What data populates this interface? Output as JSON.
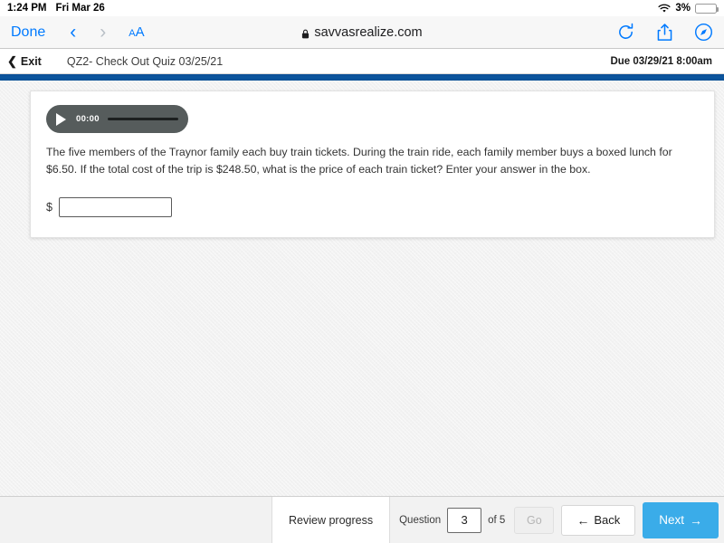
{
  "status_bar": {
    "time": "1:24 PM",
    "date": "Fri Mar 26",
    "battery_percent": "3%",
    "wifi_icon": "wifi-icon",
    "battery_icon": "battery-icon"
  },
  "browser": {
    "done_label": "Done",
    "back_icon": "chevron-left-icon",
    "forward_icon": "chevron-right-icon",
    "text_size_small": "A",
    "text_size_large": "A",
    "lock_icon": "lock-icon",
    "url": "savvasrealize.com",
    "reload_icon": "reload-icon",
    "share_icon": "share-icon",
    "compass_icon": "compass-icon"
  },
  "quiz_header": {
    "exit_label": "Exit",
    "exit_icon": "chevron-left-icon",
    "title": "QZ2- Check Out Quiz 03/25/21",
    "due": "Due 03/29/21 8:00am"
  },
  "question": {
    "audio": {
      "play_icon": "play-icon",
      "time": "00:00"
    },
    "text": "The five members of the Traynor family each buy train tickets. During the train ride, each family member buys a boxed lunch for $6.50. If the total cost of the trip is $248.50, what is the price of each train ticket? Enter your answer in the box.",
    "answer_prefix": "$",
    "answer_value": "",
    "answer_placeholder": ""
  },
  "bottom_bar": {
    "review_label": "Review progress",
    "question_label": "Question",
    "question_number": "3",
    "of_label": "of 5",
    "go_label": "Go",
    "back_label": "Back",
    "back_arrow": "←",
    "next_label": "Next",
    "next_arrow": "→"
  },
  "colors": {
    "accent_blue": "#007aff",
    "next_button": "#3aace9",
    "banner_blue": "#0b569f"
  }
}
